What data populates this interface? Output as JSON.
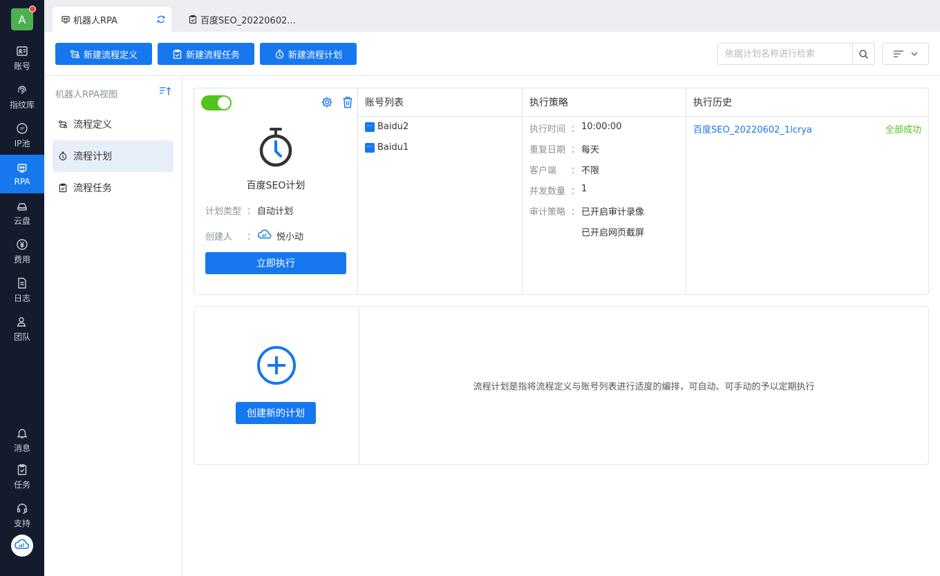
{
  "rail": {
    "avatar_letter": "A",
    "items": [
      {
        "label": "账号",
        "icon": "account-card-icon"
      },
      {
        "label": "指纹库",
        "icon": "fingerprint-icon"
      },
      {
        "label": "IP池",
        "icon": "ip-icon"
      },
      {
        "label": "RPA",
        "icon": "robot-icon",
        "active": true
      },
      {
        "label": "云盘",
        "icon": "cloud-drive-icon"
      },
      {
        "label": "费用",
        "icon": "yuan-icon"
      },
      {
        "label": "日志",
        "icon": "log-icon"
      },
      {
        "label": "团队",
        "icon": "team-icon"
      }
    ],
    "bottom_items": [
      {
        "label": "消息",
        "icon": "bell-icon"
      },
      {
        "label": "任务",
        "icon": "task-icon"
      },
      {
        "label": "支持",
        "icon": "headset-icon"
      }
    ]
  },
  "tabs": [
    {
      "label": "机器人RPA",
      "active": true
    },
    {
      "label": "百度SEO_20220602..."
    }
  ],
  "toolbar": {
    "btn_new_definition": "新建流程定义",
    "btn_new_task": "新建流程任务",
    "btn_new_plan": "新建流程计划",
    "search_placeholder": "依据计划名称进行检索"
  },
  "sidenav": {
    "title": "机器人RPA视图",
    "items": [
      {
        "label": "流程定义"
      },
      {
        "label": "流程计划",
        "active": true
      },
      {
        "label": "流程任务"
      }
    ]
  },
  "plan": {
    "name": "百度SEO计划",
    "type_label": "计划类型",
    "type_value": "自动计划",
    "creator_label": "创建人",
    "creator_value": "悦小动",
    "execute_btn": "立即执行",
    "accounts_header": "账号列表",
    "accounts": [
      "Baidu2",
      "Baidu1"
    ],
    "strategy_header": "执行策略",
    "strategy": [
      {
        "label": "执行时间",
        "value": "10:00:00"
      },
      {
        "label": "重复日期",
        "value": "每天"
      },
      {
        "label": "客户端",
        "value": "不限"
      },
      {
        "label": "并发数量",
        "value": "1"
      },
      {
        "label": "审计策略",
        "value": "已开启审计录像"
      },
      {
        "label": "",
        "value": "已开启网页截屏"
      }
    ],
    "history_header": "执行历史",
    "history_item": "百度SEO_20220602_1lcrya",
    "history_status": "全部成功"
  },
  "new_plan": {
    "create_btn": "创建新的计划",
    "hint": "流程计划是指将流程定义与账号列表进行适度的编排，可自动、可手动的予以定期执行"
  },
  "colors": {
    "primary": "#1677ef",
    "success": "#52c41a",
    "rail_bg": "#141b2d"
  }
}
